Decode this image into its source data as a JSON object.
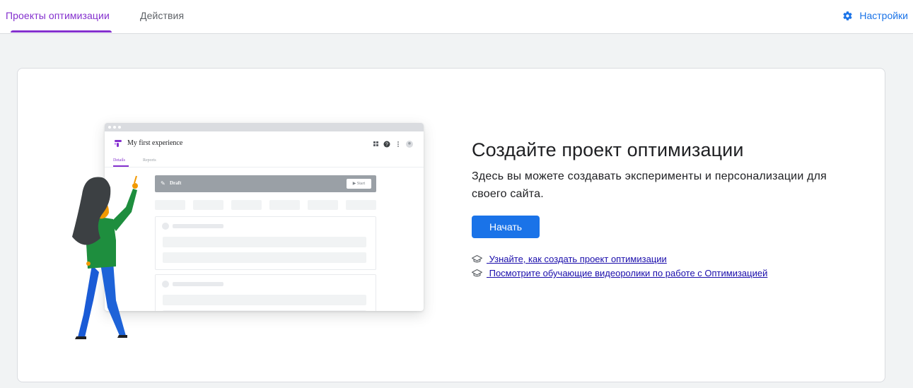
{
  "tabs": [
    {
      "label": "Проекты оптимизации",
      "active": true
    },
    {
      "label": "Действия",
      "active": false
    }
  ],
  "settings": {
    "label": "Настройки",
    "icon": "gear-icon"
  },
  "illustration": {
    "window_title": "My first experience",
    "tab_details": "Details",
    "tab_reports": "Reports",
    "draft_label": "Draft",
    "start_label": "Start"
  },
  "main": {
    "headline": "Создайте проект оптимизации",
    "description": "Здесь вы можете создавать эксперименты и персонализации для своего сайта.",
    "start_button": "Начать",
    "links": [
      {
        "text": " Узнайте, как создать проект оптимизации",
        "icon": "graduation-cap-icon"
      },
      {
        "text": " Посмотрите обучающие видеоролики по работе с Оптимизацией",
        "icon": "graduation-cap-icon"
      }
    ]
  },
  "colors": {
    "accent": "#8430ce",
    "primary": "#1a73e8",
    "link": "#1a0dab"
  }
}
